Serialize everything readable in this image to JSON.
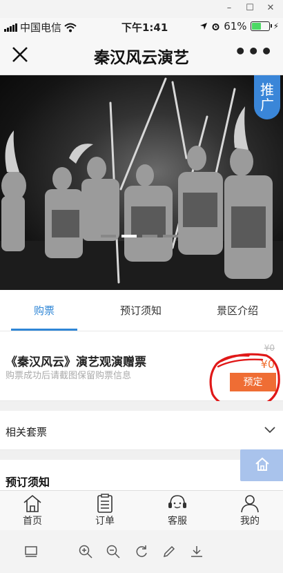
{
  "window_controls": {
    "minimize": "–",
    "maximize": "☐",
    "close": "✕"
  },
  "status_bar": {
    "carrier": "中国电信",
    "time": "下午1:41",
    "battery": "61%",
    "battery_level": 0.61
  },
  "header": {
    "close_icon": "close-icon",
    "title": "秦汉风云演艺",
    "more": "•••"
  },
  "banner": {
    "promo_label": "推广",
    "slide_count": 4,
    "active_slide": 2
  },
  "tabs": [
    {
      "label": "购票",
      "active": true
    },
    {
      "label": "预订须知",
      "active": false
    },
    {
      "label": "景区介绍",
      "active": false
    }
  ],
  "ticket": {
    "name": "《秦汉风云》演艺观演赠票",
    "description": "购票成功后请截图保留购票信息",
    "original_price": "¥0",
    "price": "¥0",
    "book_label": "预定"
  },
  "packages": {
    "label": "相关套票"
  },
  "notice": {
    "label": "预订须知"
  },
  "bottom_nav": [
    {
      "label": "首页",
      "icon": "home-icon"
    },
    {
      "label": "订单",
      "icon": "order-icon"
    },
    {
      "label": "客服",
      "icon": "customer-service-icon"
    },
    {
      "label": "我的",
      "icon": "profile-icon"
    }
  ],
  "viewer_toolbar": [
    "layout-icon",
    "zoom-in-icon",
    "zoom-out-icon",
    "rotate-icon",
    "edit-icon",
    "download-icon"
  ],
  "colors": {
    "accent": "#2f86d6",
    "price": "#f07030",
    "book_button": "#ef6d34",
    "promo": "#3a86d8",
    "annotation": "#e01818"
  }
}
